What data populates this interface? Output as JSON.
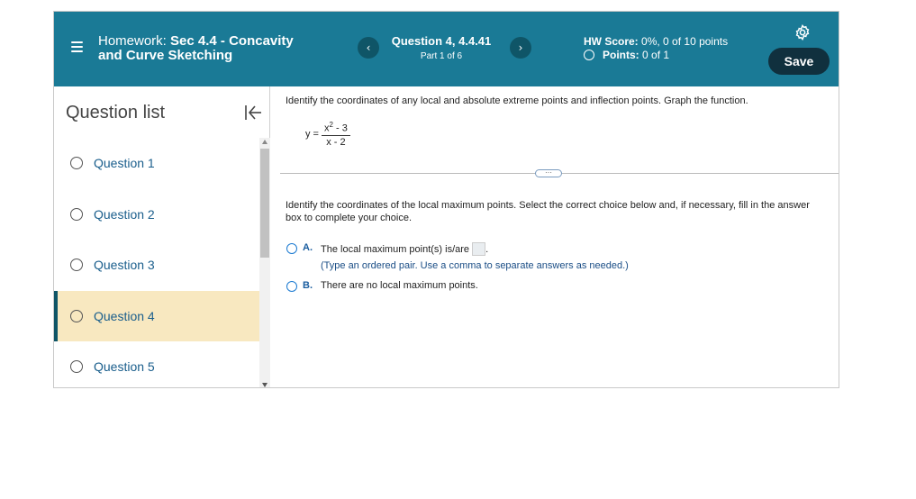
{
  "header": {
    "title_prefix": "Homework:",
    "title_main": "Sec 4.4 - Concavity",
    "title_line2": "and Curve Sketching",
    "question_title": "Question 4, 4.4.41",
    "question_part": "Part 1 of 6",
    "hw_score_label": "HW Score:",
    "hw_score_value": "0%, 0 of 10 points",
    "points_label": "Points:",
    "points_value": "0 of 1",
    "save_label": "Save",
    "prev_glyph": "‹",
    "next_glyph": "›"
  },
  "sidebar": {
    "title": "Question list",
    "items": [
      {
        "label": "Question 1"
      },
      {
        "label": "Question 2"
      },
      {
        "label": "Question 3"
      },
      {
        "label": "Question 4"
      },
      {
        "label": "Question 5"
      }
    ]
  },
  "main": {
    "instruction": "Identify the coordinates of any local and absolute extreme points and inflection points. Graph the function.",
    "equation": {
      "lhs": "y =",
      "num_base": "x",
      "num_exp": "2",
      "num_rest": " - 3",
      "den": "x - 2"
    },
    "dots": "···",
    "sub_question": "Identify the coordinates of the local maximum points. Select the correct choice below and, if necessary, fill in the answer box to complete your choice.",
    "choices": [
      {
        "letter": "A.",
        "text": "The local maximum point(s) is/are",
        "suffix": ".",
        "hint": "(Type an ordered pair. Use a comma to separate answers as needed.)"
      },
      {
        "letter": "B.",
        "text": "There are no local maximum points."
      }
    ]
  },
  "colors": {
    "header_bg": "#1a7a96",
    "save_bg": "#10303e",
    "active_bg": "#f8e8c0",
    "link": "#1a5e8c"
  }
}
